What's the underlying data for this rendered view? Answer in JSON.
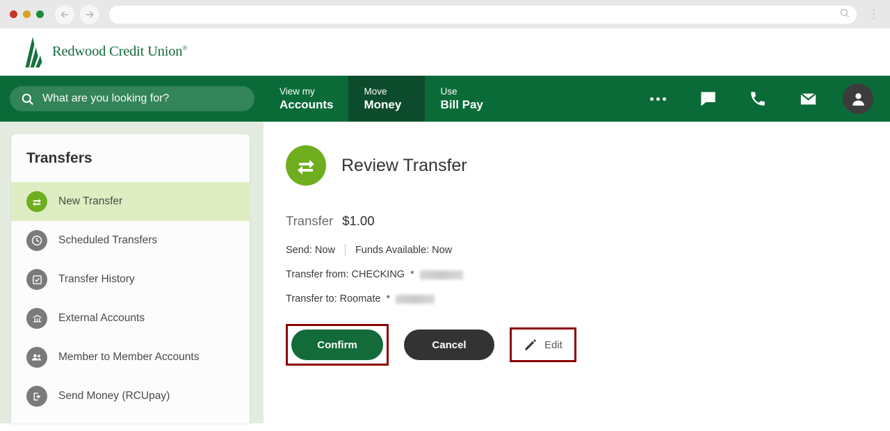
{
  "browser": {
    "back_icon": "back-arrow-icon",
    "forward_icon": "forward-arrow-icon",
    "url_value": "",
    "url_placeholder": "",
    "search_icon": "search-icon",
    "menu_icon": "kebab-menu-icon"
  },
  "header": {
    "logo_text": "Redwood Credit Union",
    "logo_trademark": "®",
    "logo_icon": "redwood-tree-logo-icon"
  },
  "nav": {
    "search_placeholder": "What are you looking for?",
    "search_icon": "search-icon",
    "tabs": [
      {
        "line1": "View my",
        "line2": "Accounts",
        "active": false
      },
      {
        "line1": "Move",
        "line2": "Money",
        "active": true
      },
      {
        "line1": "Use",
        "line2": "Bill Pay",
        "active": false
      }
    ],
    "icons": [
      {
        "name": "more-ellipsis-icon"
      },
      {
        "name": "chat-bubble-icon"
      },
      {
        "name": "phone-icon"
      },
      {
        "name": "envelope-icon"
      }
    ],
    "avatar_icon": "user-avatar-icon",
    "bg_color": "#0a6b38",
    "active_tab_color": "#0c4b2c"
  },
  "sidebar": {
    "title": "Transfers",
    "items": [
      {
        "label": "New Transfer",
        "icon": "transfer-arrows-icon",
        "active": true
      },
      {
        "label": "Scheduled Transfers",
        "icon": "clock-icon",
        "active": false
      },
      {
        "label": "Transfer History",
        "icon": "checklist-icon",
        "active": false
      },
      {
        "label": "External Accounts",
        "icon": "bank-building-icon",
        "active": false
      },
      {
        "label": "Member to Member Accounts",
        "icon": "people-icon",
        "active": false
      },
      {
        "label": "Send Money (RCUpay)",
        "icon": "send-money-icon",
        "active": false
      }
    ],
    "active_color": "#6fae1e",
    "active_row_color": "#dfeec2"
  },
  "main": {
    "title": "Review Transfer",
    "title_icon": "transfer-arrows-icon",
    "amount_label": "Transfer",
    "amount_value": "$1.00",
    "send_label": "Send: Now",
    "funds_label": "Funds Available: Now",
    "transfer_from_label": "Transfer from: CHECKING",
    "transfer_from_mask": "*",
    "transfer_to_label": "Transfer to: Roomate",
    "transfer_to_mask": "*",
    "buttons": {
      "confirm": "Confirm",
      "cancel": "Cancel",
      "edit": "Edit",
      "edit_icon": "pencil-icon"
    },
    "annotation_color": "#8b0000"
  }
}
